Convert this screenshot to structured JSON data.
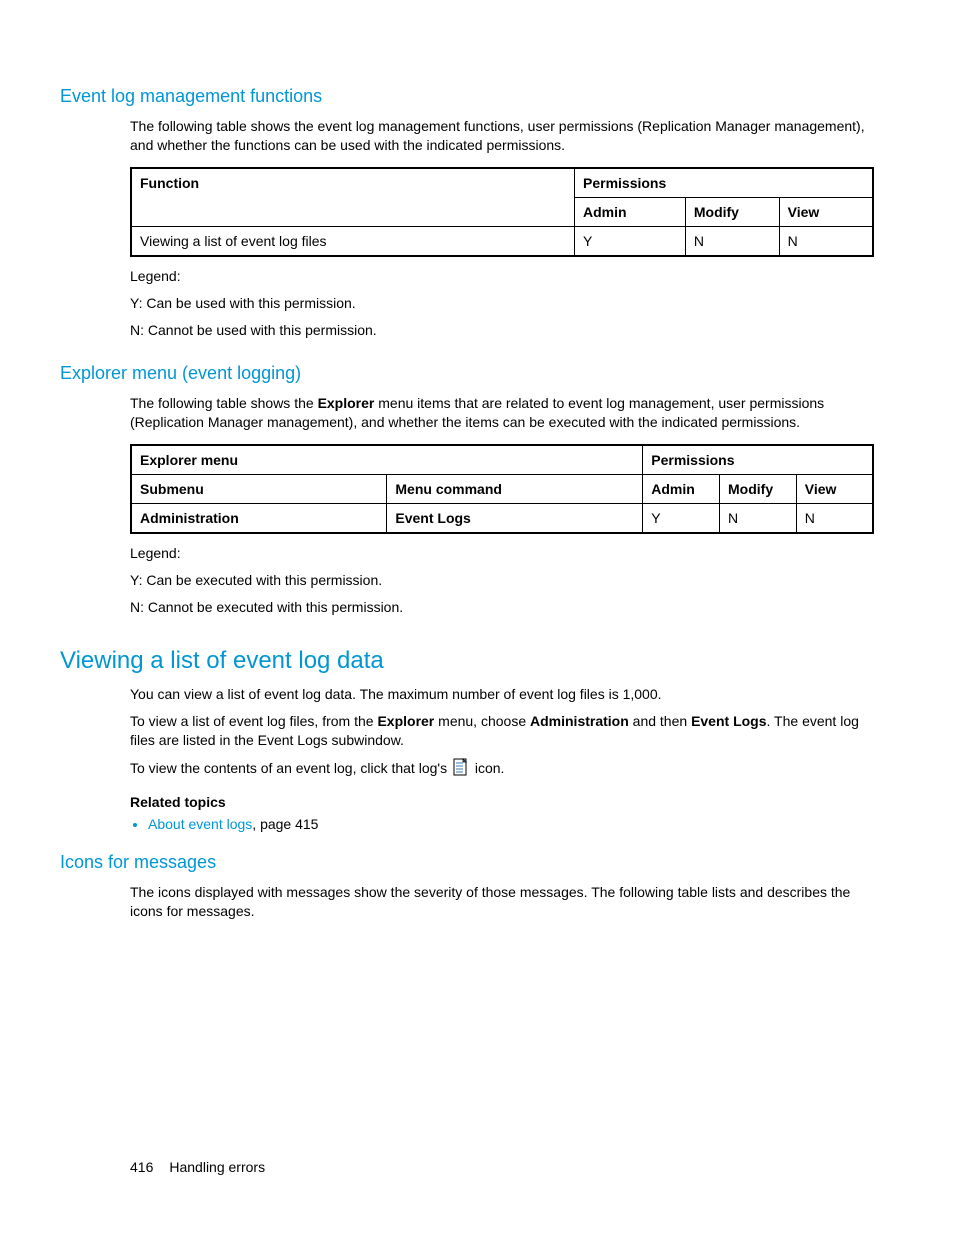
{
  "section1": {
    "heading": "Event log management functions",
    "intro": "The following table shows the event log management functions, user permissions (Replication Manager management), and whether the functions can be used with the indicated permissions.",
    "table": {
      "h_function": "Function",
      "h_permissions": "Permissions",
      "h_admin": "Admin",
      "h_modify": "Modify",
      "h_view": "View",
      "row_func": "Viewing a list of event log files",
      "row_admin": "Y",
      "row_modify": "N",
      "row_view": "N"
    },
    "legend": {
      "title": "Legend:",
      "y": "Y: Can be used with this permission.",
      "n": "N: Cannot be used with this permission."
    }
  },
  "section2": {
    "heading": "Explorer menu (event logging)",
    "intro_pre": "The following table shows the ",
    "intro_bold": "Explorer",
    "intro_post": " menu items that are related to event log management, user permissions (Replication Manager management), and whether the items can be executed with the indicated permissions.",
    "table": {
      "h_explorer": "Explorer menu",
      "h_permissions": "Permissions",
      "h_submenu": "Submenu",
      "h_menucmd": "Menu command",
      "h_admin": "Admin",
      "h_modify": "Modify",
      "h_view": "View",
      "row_submenu": "Administration",
      "row_menucmd": "Event Logs",
      "row_admin": "Y",
      "row_modify": "N",
      "row_view": "N"
    },
    "legend": {
      "title": "Legend:",
      "y": "Y: Can be executed with this permission.",
      "n": "N: Cannot be executed with this permission."
    }
  },
  "section3": {
    "heading": "Viewing a list of event log data",
    "p1": "You can view a list of event log data. The maximum number of event log files is 1,000.",
    "p2_a": "To view a list of event log files, from the ",
    "p2_b": "Explorer",
    "p2_c": " menu, choose ",
    "p2_d": "Administration",
    "p2_e": " and then ",
    "p2_f": "Event Logs",
    "p2_g": ". The event log files are listed in the Event Logs subwindow.",
    "p3_a": "To view the contents of an event log, click that log's ",
    "p3_b": " icon.",
    "related_heading": "Related topics",
    "related_link": "About event logs",
    "related_suffix": ", page 415"
  },
  "section4": {
    "heading": "Icons for messages",
    "p1": "The icons displayed with messages show the severity of those messages. The following table lists and describes the icons for messages."
  },
  "footer": {
    "pagenum": "416",
    "title": "Handling errors"
  }
}
